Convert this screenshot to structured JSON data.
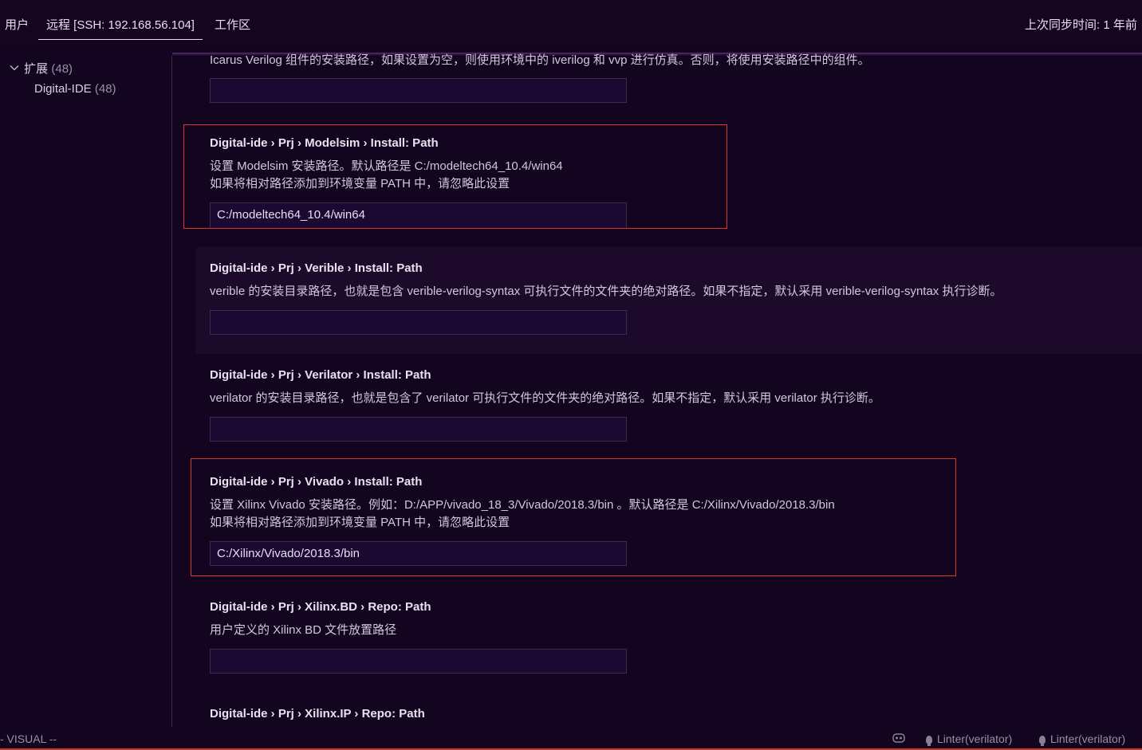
{
  "topbar": {
    "tabs": [
      {
        "label": "用户",
        "active": false
      },
      {
        "label": "远程 [SSH: 192.168.56.104]",
        "active": true
      },
      {
        "label": "工作区",
        "active": false
      }
    ],
    "last_sync": "上次同步时间: 1 年前"
  },
  "sidebar": {
    "group": {
      "label": "扩展",
      "count": "(48)"
    },
    "items": [
      {
        "label": "Digital-IDE",
        "count": "(48)"
      }
    ]
  },
  "settings": [
    {
      "title": "",
      "desc": [
        "Icarus Verilog 组件的安装路径，如果设置为空，则使用环境中的 iverilog 和 vvp 进行仿真。否则，将使用安装路径中的组件。"
      ],
      "value": ""
    },
    {
      "title": "Digital-ide › Prj › Modelsim › Install: Path",
      "desc": [
        "设置 Modelsim 安装路径。默认路径是 C:/modeltech64_10.4/win64",
        "如果将相对路径添加到环境变量 PATH 中，请忽略此设置"
      ],
      "value": "C:/modeltech64_10.4/win64"
    },
    {
      "title": "Digital-ide › Prj › Verible › Install: Path",
      "desc": [
        "verible 的安装目录路径，也就是包含 verible-verilog-syntax 可执行文件的文件夹的绝对路径。如果不指定，默认采用 verible-verilog-syntax 执行诊断。"
      ],
      "value": ""
    },
    {
      "title": "Digital-ide › Prj › Verilator › Install: Path",
      "desc": [
        "verilator 的安装目录路径，也就是包含了 verilator 可执行文件的文件夹的绝对路径。如果不指定，默认采用 verilator 执行诊断。"
      ],
      "value": ""
    },
    {
      "title": "Digital-ide › Prj › Vivado › Install: Path",
      "desc": [
        "设置 Xilinx Vivado 安装路径。例如：D:/APP/vivado_18_3/Vivado/2018.3/bin 。默认路径是 C:/Xilinx/Vivado/2018.3/bin",
        "如果将相对路径添加到环境变量 PATH 中，请忽略此设置"
      ],
      "value": "C:/Xilinx/Vivado/2018.3/bin"
    },
    {
      "title": "Digital-ide › Prj › Xilinx.BD › Repo: Path",
      "desc": [
        "用户定义的 Xilinx BD 文件放置路径"
      ],
      "value": ""
    },
    {
      "title": "Digital-ide › Prj › Xilinx.IP › Repo: Path",
      "desc": [],
      "value": ""
    }
  ],
  "statusbar": {
    "mode": "- VISUAL --",
    "linters": [
      "Linter(verilator)",
      "Linter(verilator)"
    ]
  },
  "colors": {
    "background": "#13041f",
    "highlight_row": "#1d0a2b",
    "red_outline": "#d93a2f",
    "input_bg": "#1b0932"
  }
}
